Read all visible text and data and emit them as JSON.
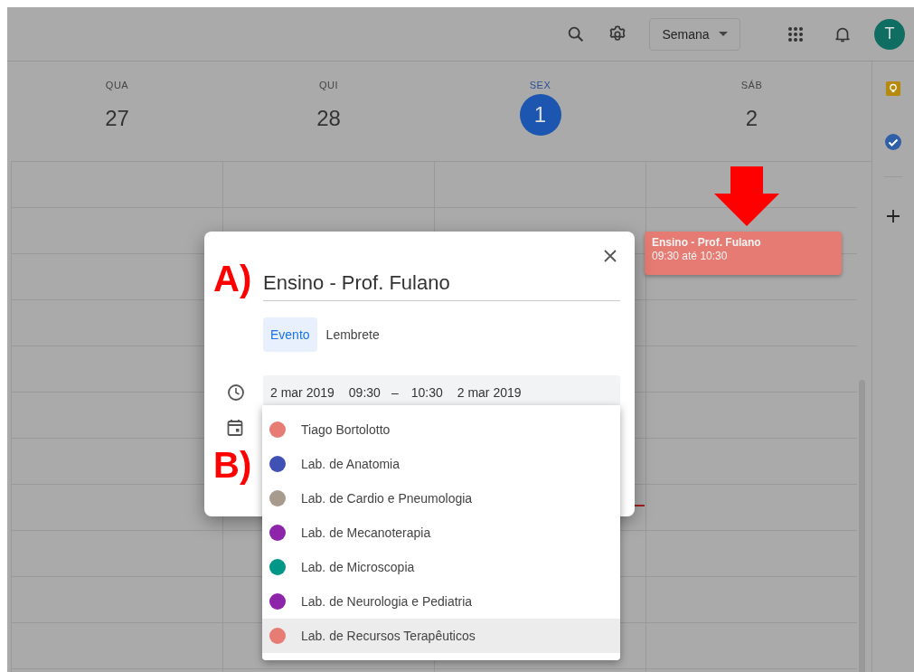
{
  "header": {
    "view_selector": "Semana",
    "avatar_letter": "T"
  },
  "days": [
    {
      "weekday": "QUA",
      "date": "27",
      "today": false
    },
    {
      "weekday": "QUI",
      "date": "28",
      "today": false
    },
    {
      "weekday": "SEX",
      "date": "1",
      "today": true
    },
    {
      "weekday": "SÁB",
      "date": "2",
      "today": false
    }
  ],
  "event": {
    "title": "Ensino - Prof. Fulano",
    "time": "09:30 até 10:30"
  },
  "dialog": {
    "title_value": "Ensino - Prof. Fulano",
    "tabs": [
      {
        "label": "Evento",
        "selected": true
      },
      {
        "label": "Lembrete",
        "selected": false
      }
    ],
    "date_time": {
      "start_date": "2 mar 2019",
      "start_time": "09:30",
      "separator": "–",
      "end_time": "10:30",
      "end_date": "2 mar 2019"
    },
    "calendar_menu": [
      {
        "name": "Tiago Bortolotto",
        "color": "#e67c73",
        "selected": false
      },
      {
        "name": "Lab. de Anatomia",
        "color": "#3f51b5",
        "selected": false
      },
      {
        "name": "Lab. de Cardio e Pneumologia",
        "color": "#a79b8e",
        "selected": false
      },
      {
        "name": "Lab. de Mecanoterapia",
        "color": "#8e24aa",
        "selected": false
      },
      {
        "name": "Lab. de Microscopia",
        "color": "#009688",
        "selected": false
      },
      {
        "name": "Lab. de Neurologia e Pediatria",
        "color": "#8e24aa",
        "selected": false
      },
      {
        "name": "Lab. de Recursos Terapêuticos",
        "color": "#e67c73",
        "selected": true
      }
    ]
  },
  "annotations": [
    {
      "label": "A)"
    },
    {
      "label": "B)"
    }
  ]
}
